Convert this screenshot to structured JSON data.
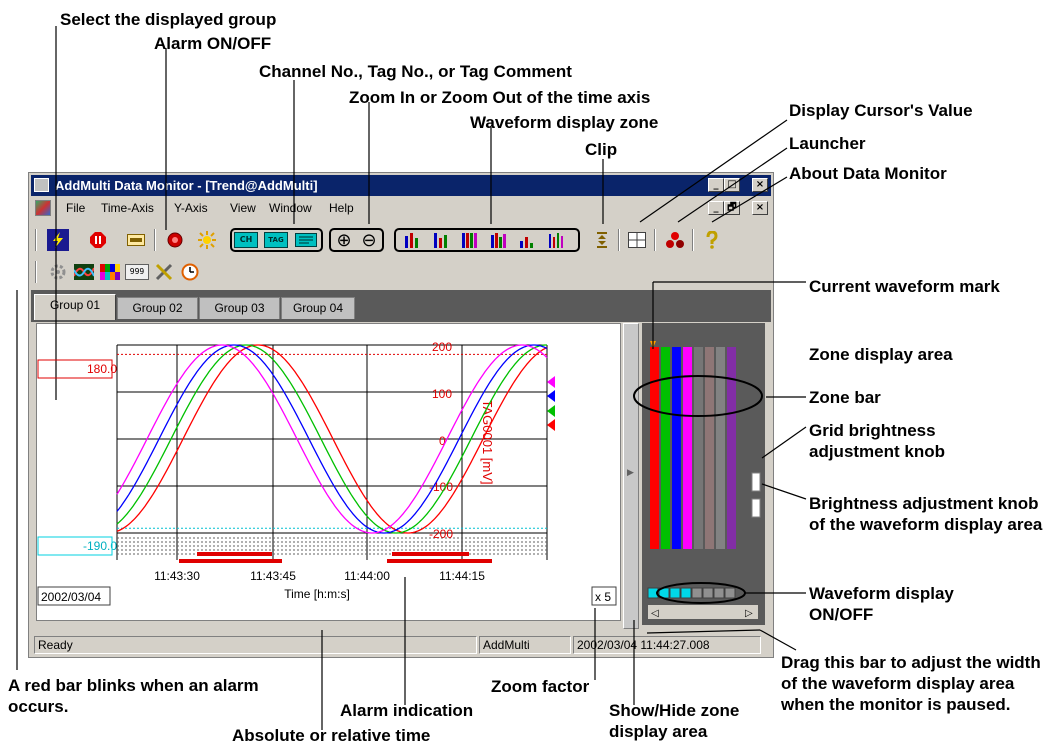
{
  "callouts": {
    "select_group": "Select the displayed group",
    "alarm_onoff": "Alarm ON/OFF",
    "channel_tag": "Channel No., Tag No., or Tag Comment",
    "zoom_time": "Zoom In or Zoom Out of the time axis",
    "waveform_zone": "Waveform display zone",
    "clip": "Clip",
    "display_cursor": "Display Cursor's Value",
    "launcher": "Launcher",
    "about": "About Data Monitor",
    "current_mark": "Current waveform mark",
    "zone_area": "Zone display area",
    "zone_bar": "Zone bar",
    "grid_knob": "Grid brightness adjustment knob",
    "brightness_knob": "Brightness adjustment knob of the waveform display area",
    "waveform_onoff": "Waveform display ON/OFF",
    "red_bar": "A red bar blinks when an alarm occurs.",
    "zoom_factor": "Zoom factor",
    "alarm_indication": "Alarm indication",
    "abs_rel_time": "Absolute or relative time",
    "show_hide_zone": "Show/Hide zone display area",
    "drag_bar": "Drag this bar to adjust the width of the waveform display area when the monitor is paused."
  },
  "window": {
    "title": "AddMulti Data Monitor - [Trend@AddMulti]",
    "menu": [
      "File",
      "Time-Axis",
      "Y-Axis",
      "View",
      "Window",
      "Help"
    ],
    "title_buttons": [
      "_",
      "□",
      "×"
    ],
    "mdi_buttons": [
      "_",
      "🗗",
      "×"
    ]
  },
  "toolbar": {
    "row1_icons": [
      "lightning-icon",
      "stop-icon",
      "group-icon",
      "alarm-icon",
      "sun-icon",
      "ch-icon",
      "tag-icon",
      "comment-icon",
      "zoom-in-icon",
      "zoom-out-icon",
      "zone1-icon",
      "zone2-icon",
      "zone3-icon",
      "zone4-icon",
      "zone5-icon",
      "zone6-icon",
      "clip-icon",
      "cursor-value-icon",
      "launcher-icon",
      "about-icon"
    ],
    "row2_icons": [
      "settings-icon",
      "waveform-color-icon",
      "color-grid-icon",
      "digits-icon",
      "tools-icon",
      "clock-icon"
    ],
    "ch_label": "CH",
    "tag_label": "TAG",
    "digits_label": "999",
    "zoom_in": "⊕",
    "zoom_out": "⊖"
  },
  "tabs": [
    "Group 01",
    "Group 02",
    "Group 03",
    "Group 04"
  ],
  "plot": {
    "upper_marker": "180.0",
    "lower_marker": "-190.0",
    "x_ticks": [
      "11:43:30",
      "11:43:45",
      "11:44:00",
      "11:44:15"
    ],
    "x_label": "Time [h:m:s]",
    "date": "2002/03/04",
    "zoom": "x 5",
    "y_ticks": [
      "200",
      "100",
      "0",
      "-100",
      "-200"
    ],
    "y_label": "TAG0001 [mV]",
    "series_colors": [
      "#ff0000",
      "#00c000",
      "#0000ff",
      "#ff00ff"
    ]
  },
  "status": {
    "ready": "Ready",
    "app": "AddMulti",
    "time": "2002/03/04 11:44:27.008"
  },
  "colors": {
    "title_bg": "#0a246a",
    "zone_bg": "#5a5a5a",
    "accent": "#ff0000"
  }
}
